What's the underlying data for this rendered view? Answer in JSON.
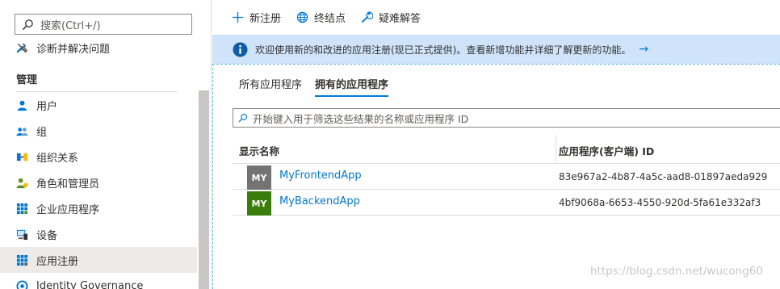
{
  "sidebar": {
    "search_placeholder": "搜索(Ctrl+/)",
    "collapse_glyph": "«",
    "diagnose_label": "诊断并解决问题",
    "section_title": "管理",
    "items": [
      {
        "label": "用户",
        "icon": "user-icon"
      },
      {
        "label": "组",
        "icon": "group-icon"
      },
      {
        "label": "组织关系",
        "icon": "org-relationship-icon"
      },
      {
        "label": "角色和管理员",
        "icon": "roles-admins-icon"
      },
      {
        "label": "企业应用程序",
        "icon": "enterprise-apps-icon"
      },
      {
        "label": "设备",
        "icon": "devices-icon"
      },
      {
        "label": "应用注册",
        "icon": "app-registrations-icon",
        "active": true
      },
      {
        "label": "Identity Governance",
        "icon": "identity-governance-icon"
      }
    ]
  },
  "toolbar": {
    "new_registration": "新注册",
    "endpoints": "终结点",
    "troubleshoot": "疑难解答"
  },
  "banner": {
    "text": "欢迎使用新的和改进的应用注册(现已正式提供)。查看新增功能并详细了解更新的功能。",
    "arrow": "→"
  },
  "tabs": {
    "all_apps": "所有应用程序",
    "owned_apps": "拥有的应用程序"
  },
  "filter": {
    "placeholder": "开始键入用于筛选这些结果的名称或应用程序 ID"
  },
  "table": {
    "col_display_name": "显示名称",
    "col_app_id": "应用程序(客户端) ID",
    "rows": [
      {
        "initials": "MY",
        "name": "MyFrontendApp",
        "app_id": "83e967a2-4b87-4a5c-aad8-01897aeda929",
        "color": "#737373"
      },
      {
        "initials": "MY",
        "name": "MyBackendApp",
        "app_id": "4bf9068a-6653-4550-920d-5fa61e332af3",
        "color": "#3b7d0c"
      }
    ]
  },
  "watermark": "https://blog.csdn.net/wucong60",
  "colors": {
    "accent": "#0078d4",
    "banner_bg": "#cfe4fa",
    "active_nav_bg": "#edebe9"
  }
}
